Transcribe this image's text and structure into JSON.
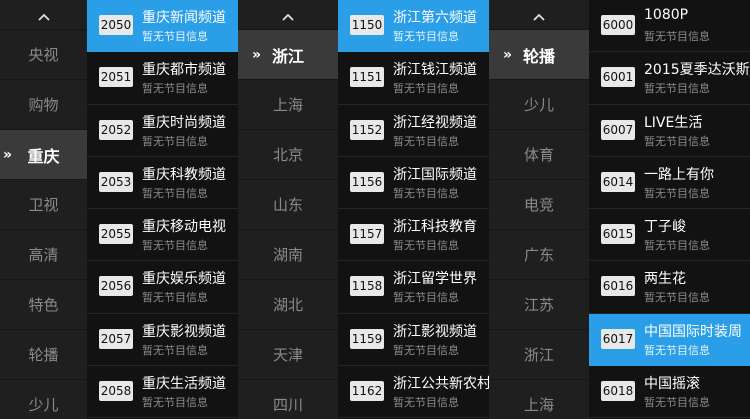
{
  "no_program_text": "暂无节目信息",
  "accent_color": "#2a9ee6",
  "icons": {
    "scroll_up": "chevron-up-icon",
    "selected_marker": "double-chevron-right-icon"
  },
  "group1": {
    "categories": [
      {
        "label": "央视"
      },
      {
        "label": "购物"
      },
      {
        "label": "重庆",
        "selected": true
      },
      {
        "label": "卫视"
      },
      {
        "label": "高清"
      },
      {
        "label": "特色"
      },
      {
        "label": "轮播"
      },
      {
        "label": "少儿"
      }
    ],
    "channels": [
      {
        "num": "2050",
        "name": "重庆新闻频道",
        "selected": true
      },
      {
        "num": "2051",
        "name": "重庆都市频道"
      },
      {
        "num": "2052",
        "name": "重庆时尚频道"
      },
      {
        "num": "2053",
        "name": "重庆科教频道"
      },
      {
        "num": "2055",
        "name": "重庆移动电视"
      },
      {
        "num": "2056",
        "name": "重庆娱乐频道"
      },
      {
        "num": "2057",
        "name": "重庆影视频道"
      },
      {
        "num": "2058",
        "name": "重庆生活频道"
      }
    ]
  },
  "group2": {
    "categories": [
      {
        "label": "浙江",
        "selected": true
      },
      {
        "label": "上海"
      },
      {
        "label": "北京"
      },
      {
        "label": "山东"
      },
      {
        "label": "湖南"
      },
      {
        "label": "湖北"
      },
      {
        "label": "天津"
      },
      {
        "label": "四川"
      }
    ],
    "channels": [
      {
        "num": "1150",
        "name": "浙江第六频道",
        "selected": true
      },
      {
        "num": "1151",
        "name": "浙江钱江频道"
      },
      {
        "num": "1152",
        "name": "浙江经视频道"
      },
      {
        "num": "1156",
        "name": "浙江国际频道"
      },
      {
        "num": "1157",
        "name": "浙江科技教育"
      },
      {
        "num": "1158",
        "name": "浙江留学世界"
      },
      {
        "num": "1159",
        "name": "浙江影视频道"
      },
      {
        "num": "1162",
        "name": "浙江公共新农村"
      }
    ]
  },
  "group3": {
    "categories": [
      {
        "label": "轮播",
        "selected": true
      },
      {
        "label": "少儿"
      },
      {
        "label": "体育"
      },
      {
        "label": "电竞"
      },
      {
        "label": "广东"
      },
      {
        "label": "江苏"
      },
      {
        "label": "浙江"
      },
      {
        "label": "上海"
      }
    ],
    "channels": [
      {
        "num": "6000",
        "name": "1080P"
      },
      {
        "num": "6001",
        "name": "2015夏季达沃斯"
      },
      {
        "num": "6007",
        "name": "LIVE生活"
      },
      {
        "num": "6014",
        "name": "一路上有你"
      },
      {
        "num": "6015",
        "name": "丁子峻"
      },
      {
        "num": "6016",
        "name": "两生花"
      },
      {
        "num": "6017",
        "name": "中国国际时装周",
        "selected": true
      },
      {
        "num": "6018",
        "name": "中国摇滚"
      }
    ]
  }
}
